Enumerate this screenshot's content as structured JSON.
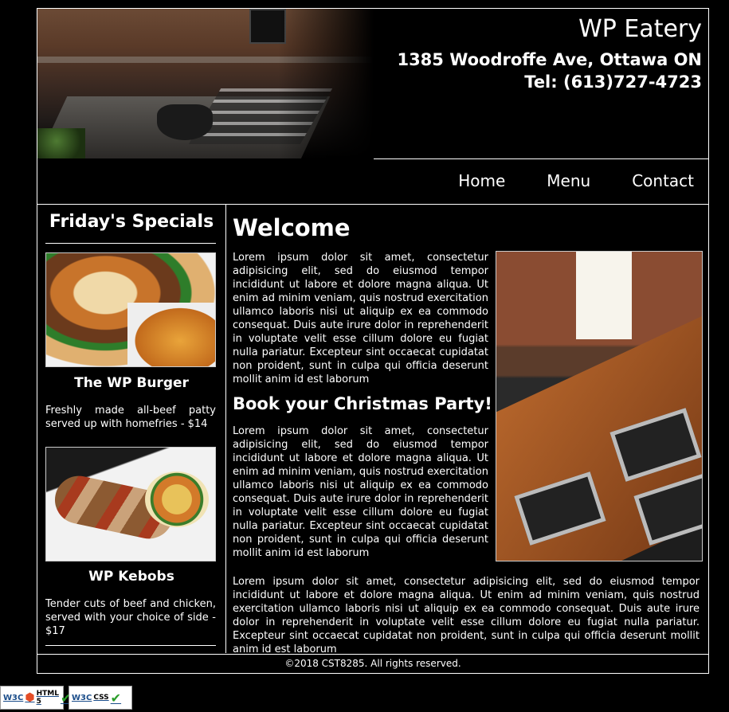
{
  "header": {
    "restaurant_name": "WP Eatery",
    "address": "1385 Woodroffe Ave, Ottawa ON",
    "phone": "Tel: (613)727-4723"
  },
  "nav": {
    "items": [
      {
        "label": "Home"
      },
      {
        "label": "Menu"
      },
      {
        "label": "Contact"
      }
    ]
  },
  "sidebar": {
    "title": "Friday's Specials",
    "dishes": [
      {
        "name": "The WP Burger",
        "description": "Freshly made all-beef patty served up with homefries - $14"
      },
      {
        "name": "WP Kebobs",
        "description": "Tender cuts of beef and chicken, served with your choice of side - $17"
      }
    ]
  },
  "main": {
    "heading": "Welcome",
    "paragraph_1": "Lorem ipsum dolor sit amet, consectetur adipisicing elit, sed do eiusmod tempor incididunt ut labore et dolore magna aliqua. Ut enim ad minim veniam, quis nostrud exercitation ullamco laboris nisi ut aliquip ex ea commodo consequat. Duis aute irure dolor in reprehenderit in voluptate velit esse cillum dolore eu fugiat nulla pariatur. Excepteur sint occaecat cupidatat non proident, sunt in culpa qui officia deserunt mollit anim id est laborum",
    "subheading": "Book your Christmas Party!",
    "paragraph_2": "Lorem ipsum dolor sit amet, consectetur adipisicing elit, sed do eiusmod tempor incididunt ut labore et dolore magna aliqua. Ut enim ad minim veniam, quis nostrud exercitation ullamco laboris nisi ut aliquip ex ea commodo consequat. Duis aute irure dolor in reprehenderit in voluptate velit esse cillum dolore eu fugiat nulla pariatur. Excepteur sint occaecat cupidatat non proident, sunt in culpa qui officia deserunt mollit anim id est laborum",
    "paragraph_3": "Lorem ipsum dolor sit amet, consectetur adipisicing elit, sed do eiusmod tempor incididunt ut labore et dolore magna aliqua. Ut enim ad minim veniam, quis nostrud exercitation ullamco laboris nisi ut aliquip ex ea commodo consequat. Duis aute irure dolor in reprehenderit in voluptate velit esse cillum dolore eu fugiat nulla pariatur. Excepteur sint occaecat cupidatat non proident, sunt in culpa qui officia deserunt mollit anim id est laborum"
  },
  "footer": {
    "copyright": "©2018 CST8285. All rights reserved."
  },
  "badges": [
    {
      "w3c": "W3C",
      "label": "HTML 5",
      "icon": "html5-check-icon"
    },
    {
      "w3c": "W3C",
      "label": "CSS",
      "icon": "css-check-icon"
    }
  ],
  "colors": {
    "background": "#000000",
    "text": "#ffffff",
    "border": "#ffffff"
  }
}
